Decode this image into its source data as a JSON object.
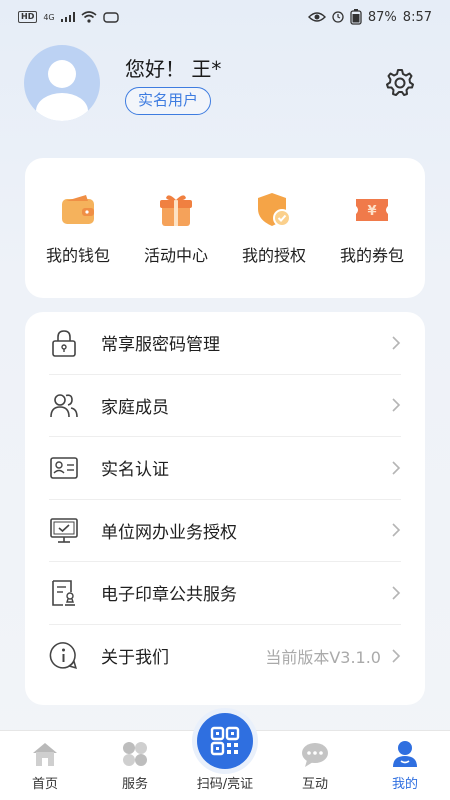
{
  "status_bar": {
    "network": "HD",
    "signal_type": "4G",
    "battery": "87%",
    "time": "8:57"
  },
  "profile": {
    "greeting": "您好！ 王*",
    "verified_badge": "实名用户"
  },
  "quick_actions": [
    {
      "label": "我的钱包",
      "icon": "wallet-icon"
    },
    {
      "label": "活动中心",
      "icon": "gift-icon"
    },
    {
      "label": "我的授权",
      "icon": "shield-check-icon"
    },
    {
      "label": "我的券包",
      "icon": "coupon-icon"
    }
  ],
  "menu": [
    {
      "label": "常享服密码管理",
      "icon": "lock-icon",
      "extra": ""
    },
    {
      "label": "家庭成员",
      "icon": "family-icon",
      "extra": ""
    },
    {
      "label": "实名认证",
      "icon": "id-card-icon",
      "extra": ""
    },
    {
      "label": "单位网办业务授权",
      "icon": "monitor-check-icon",
      "extra": ""
    },
    {
      "label": "电子印章公共服务",
      "icon": "seal-document-icon",
      "extra": ""
    },
    {
      "label": "关于我们",
      "icon": "info-icon",
      "extra": "当前版本V3.1.0"
    }
  ],
  "tabs": [
    {
      "label": "首页",
      "icon": "home-icon"
    },
    {
      "label": "服务",
      "icon": "grid-icon"
    },
    {
      "label": "扫码/亮证",
      "icon": "qr-code-icon"
    },
    {
      "label": "互动",
      "icon": "chat-icon"
    },
    {
      "label": "我的",
      "icon": "user-icon"
    }
  ],
  "colors": {
    "accent": "#2f6fe0",
    "icon_orange": "#f39a4a"
  }
}
